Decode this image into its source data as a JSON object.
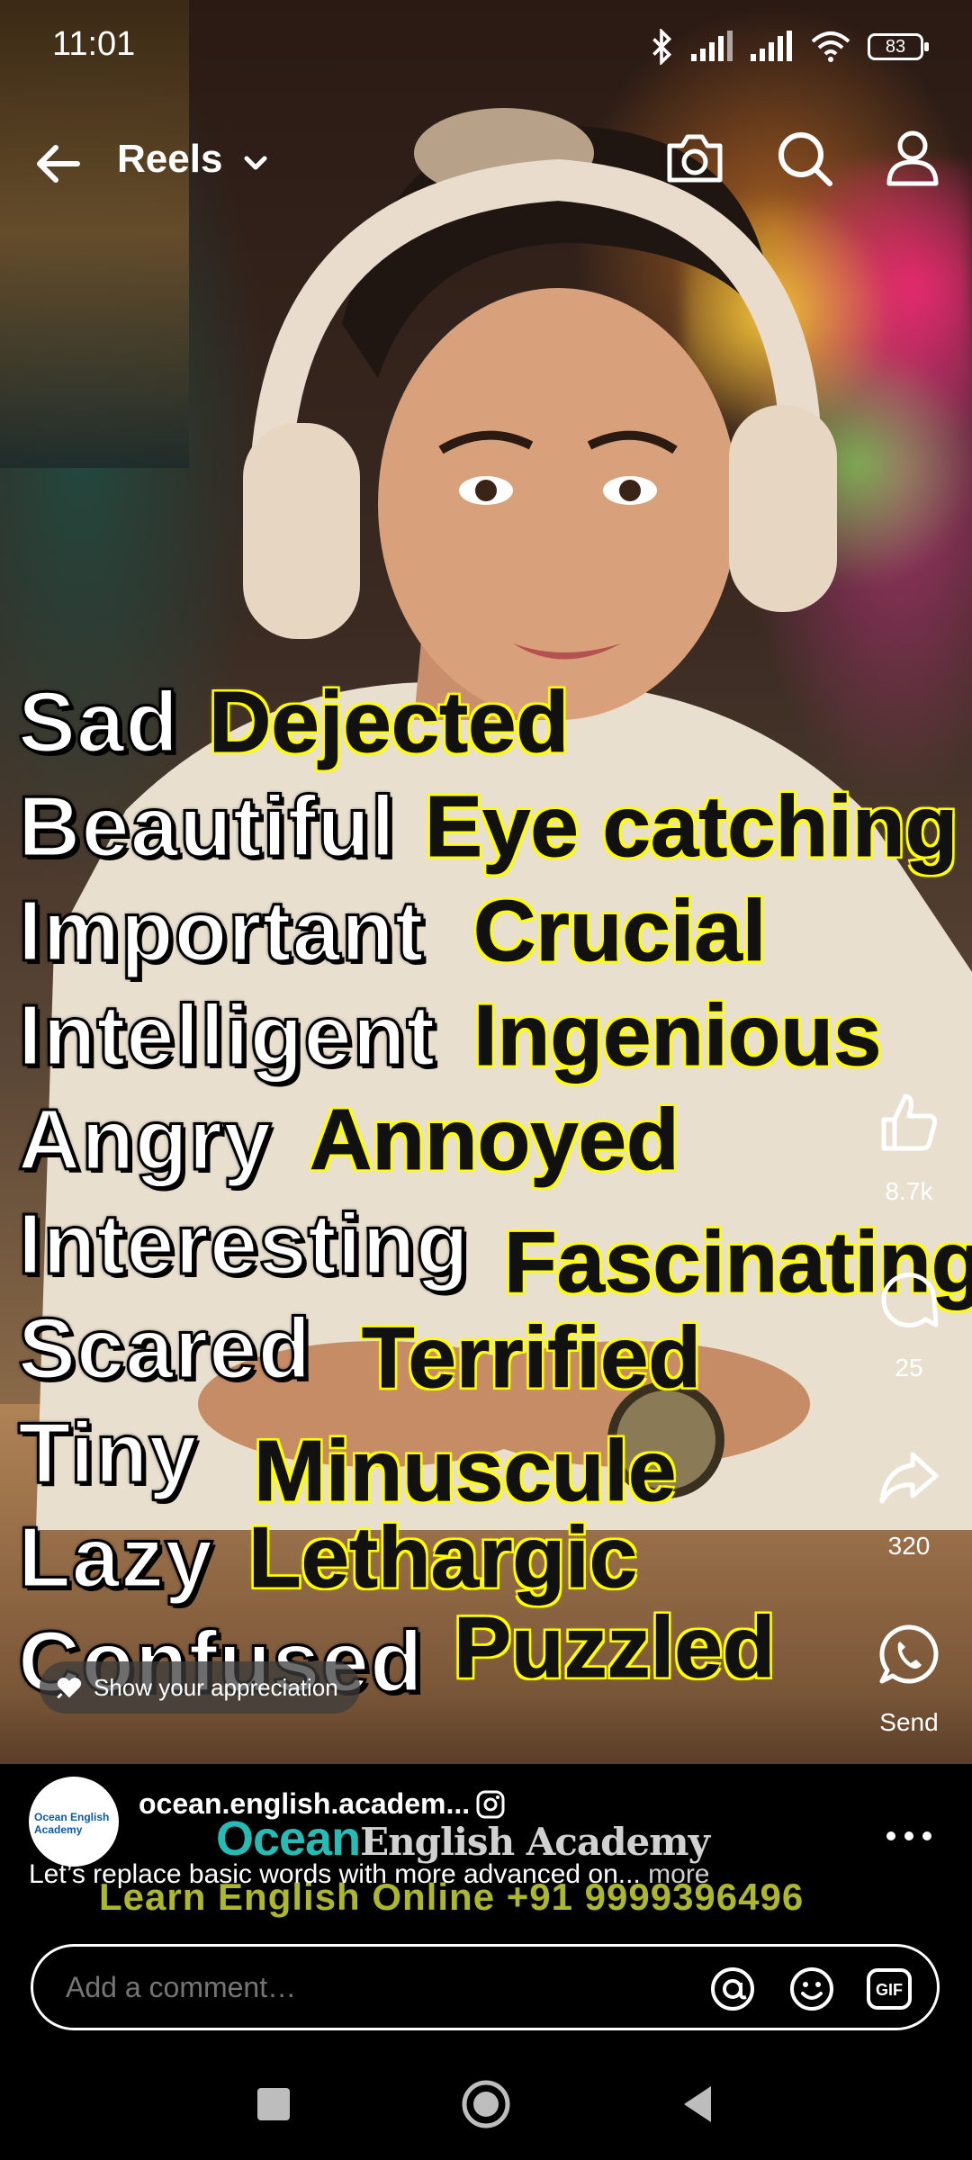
{
  "status_bar": {
    "time": "11:01",
    "battery": "83",
    "icons": [
      "bluetooth-icon",
      "signal-icon",
      "signal-icon",
      "wifi-icon",
      "battery-icon"
    ]
  },
  "header": {
    "title": "Reels",
    "icons": [
      "back-arrow-icon",
      "chevron-down-icon",
      "camera-icon",
      "search-icon",
      "profile-icon"
    ]
  },
  "overlay": {
    "rows": [
      {
        "basic": "Sad",
        "advanced": "Dejected"
      },
      {
        "basic": "Beautiful",
        "advanced": "Eye catching"
      },
      {
        "basic": "Important",
        "advanced": "Crucial"
      },
      {
        "basic": "Intelligent",
        "advanced": "Ingenious"
      },
      {
        "basic": "Angry",
        "advanced": "Annoyed"
      },
      {
        "basic": "Interesting",
        "advanced": "Fascinating"
      },
      {
        "basic": "Scared",
        "advanced": "Terrified"
      },
      {
        "basic": "Tiny",
        "advanced": "Minuscule"
      },
      {
        "basic": "Lazy",
        "advanced": "Lethargic"
      },
      {
        "basic": "Confused",
        "advanced": "Puzzled"
      }
    ],
    "accent_color": "#ffff00"
  },
  "actions": {
    "like_count": "8.7k",
    "comment_count": "25",
    "share_count": "320",
    "send_label": "Send"
  },
  "appreciation": {
    "label": "Show your appreciation"
  },
  "post": {
    "username": "ocean.english.academ...",
    "avatar_text": "Ocean English Academy",
    "caption": "Let’s replace basic words with more advanced on... ",
    "more_label": "more",
    "watermark_brand": "Ocean",
    "watermark_brand_sub": "English Academy",
    "watermark_line": "Learn English Online +91 9999396496"
  },
  "comment": {
    "placeholder": "Add a comment…",
    "icons": [
      "mention-icon",
      "emoji-icon",
      "gif-icon"
    ]
  },
  "navbar": {
    "icons": [
      "recents-square-icon",
      "home-circle-icon",
      "back-triangle-icon"
    ]
  }
}
